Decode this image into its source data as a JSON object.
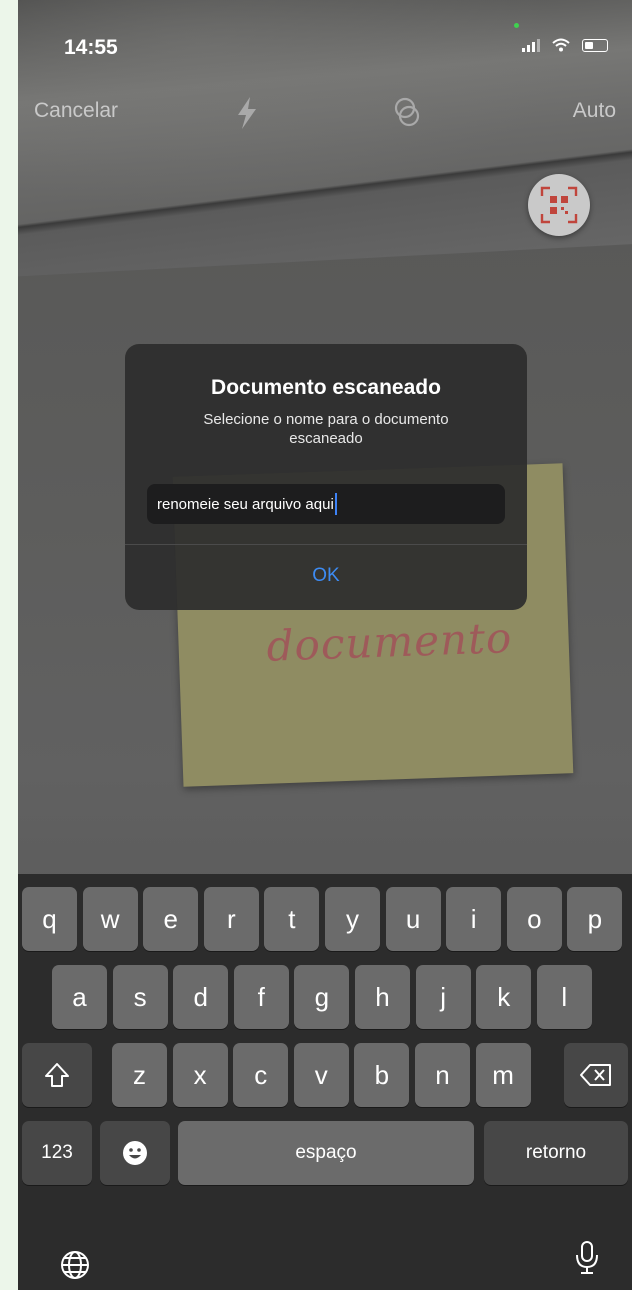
{
  "status_bar": {
    "time": "14:55"
  },
  "camera_toolbar": {
    "cancel_label": "Cancelar",
    "flash_icon": "flash-icon",
    "filter_icon": "filter-icon",
    "auto_label": "Auto"
  },
  "qr_icon": "qr-code-scan-icon",
  "background_note_text": "documento",
  "dialog": {
    "title": "Documento escaneado",
    "message": "Selecione o nome para o documento escaneado",
    "input_value": "renomeie seu arquivo aqui",
    "ok_label": "OK"
  },
  "keyboard": {
    "row1": [
      "q",
      "w",
      "e",
      "r",
      "t",
      "y",
      "u",
      "i",
      "o",
      "p"
    ],
    "row2": [
      "a",
      "s",
      "d",
      "f",
      "g",
      "h",
      "j",
      "k",
      "l"
    ],
    "row3": [
      "z",
      "x",
      "c",
      "v",
      "b",
      "n",
      "m"
    ],
    "numbers_label": "123",
    "space_label": "espaço",
    "return_label": "retorno",
    "shift_icon": "shift-icon",
    "delete_icon": "backspace-icon",
    "emoji_icon": "emoji-icon",
    "globe_icon": "globe-icon",
    "mic_icon": "microphone-icon"
  },
  "colors": {
    "accent": "#3d8bf2",
    "page_background": "#ecf6ea"
  }
}
